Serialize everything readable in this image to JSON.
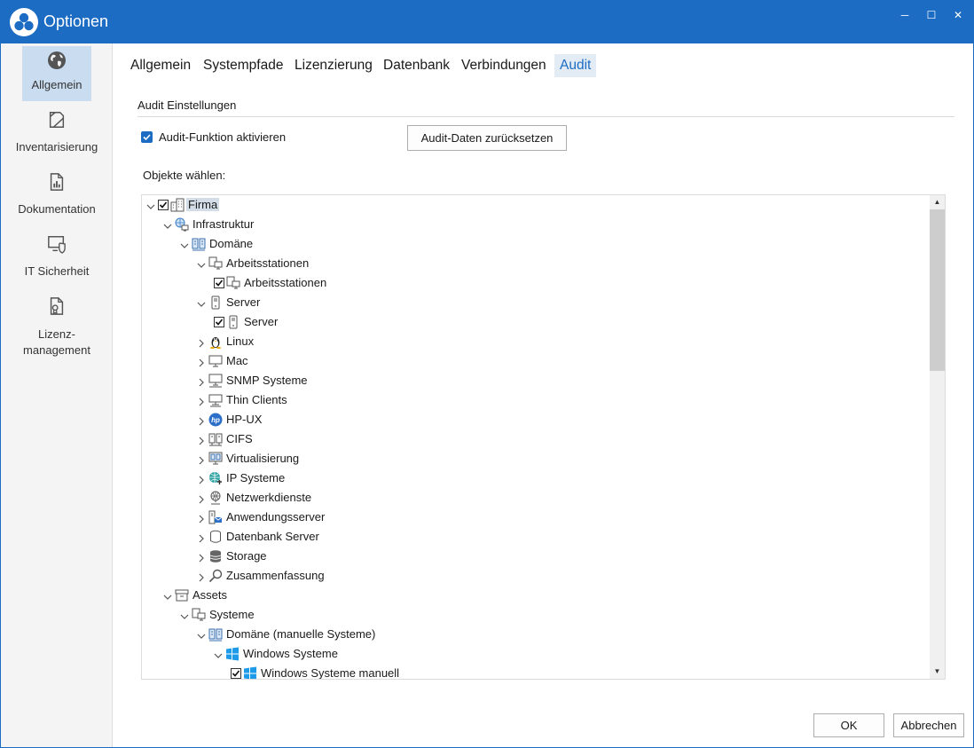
{
  "window": {
    "title": "Optionen",
    "title_color": "#1d6cc3",
    "controls": {
      "minimize": "─",
      "maximize": "☐",
      "close": "✕"
    }
  },
  "sidebar": {
    "items": [
      {
        "label": "Allgemein",
        "icon": "globe-icon",
        "active": true
      },
      {
        "label": "Inventarisierung",
        "icon": "inventory-icon",
        "active": false
      },
      {
        "label": "Dokumentation",
        "icon": "document-chart-icon",
        "active": false
      },
      {
        "label": "IT Sicherheit",
        "icon": "shield-monitor-icon",
        "active": false
      },
      {
        "label": "Lizenz-",
        "label2": "management",
        "icon": "license-icon",
        "active": false
      }
    ]
  },
  "tabs": [
    {
      "label": "Allgemein",
      "active": false
    },
    {
      "label": "Systempfade",
      "active": false
    },
    {
      "label": "Lizenzierung",
      "active": false
    },
    {
      "label": "Datenbank",
      "active": false
    },
    {
      "label": "Verbindungen",
      "active": false
    },
    {
      "label": "Audit",
      "active": true
    }
  ],
  "audit": {
    "section_title": "Audit Einstellungen",
    "enable_label": "Audit-Funktion aktivieren",
    "enable_checked": true,
    "reset_button": "Audit-Daten zurücksetzen",
    "objects_label": "Objekte wählen:"
  },
  "tree": [
    {
      "label": "Firma",
      "level": 0,
      "expanded": true,
      "checkbox": true,
      "checked": true,
      "icon": "building-icon",
      "selected": true
    },
    {
      "label": "Infrastruktur",
      "level": 1,
      "expanded": true,
      "checkbox": false,
      "icon": "network-globe-icon"
    },
    {
      "label": "Domäne",
      "level": 2,
      "expanded": true,
      "checkbox": false,
      "icon": "domain-icon"
    },
    {
      "label": "Arbeitsstationen",
      "level": 3,
      "expanded": true,
      "checkbox": false,
      "icon": "workstation-icon"
    },
    {
      "label": "Arbeitsstationen",
      "level": 4,
      "leaf": true,
      "checkbox": true,
      "checked": true,
      "icon": "workstation-icon"
    },
    {
      "label": "Server",
      "level": 3,
      "expanded": true,
      "checkbox": false,
      "icon": "server-icon"
    },
    {
      "label": "Server",
      "level": 4,
      "leaf": true,
      "checkbox": true,
      "checked": true,
      "icon": "server-icon"
    },
    {
      "label": "Linux",
      "level": 3,
      "expanded": false,
      "checkbox": false,
      "icon": "linux-icon"
    },
    {
      "label": "Mac",
      "level": 3,
      "expanded": false,
      "checkbox": false,
      "icon": "monitor-icon"
    },
    {
      "label": "SNMP Systeme",
      "level": 3,
      "expanded": false,
      "checkbox": false,
      "icon": "snmp-icon"
    },
    {
      "label": "Thin Clients",
      "level": 3,
      "expanded": false,
      "checkbox": false,
      "icon": "thin-client-icon"
    },
    {
      "label": "HP-UX",
      "level": 3,
      "expanded": false,
      "checkbox": false,
      "icon": "hp-icon"
    },
    {
      "label": "CIFS",
      "level": 3,
      "expanded": false,
      "checkbox": false,
      "icon": "cifs-icon"
    },
    {
      "label": "Virtualisierung",
      "level": 3,
      "expanded": false,
      "checkbox": false,
      "icon": "virtualization-icon"
    },
    {
      "label": "IP Systeme",
      "level": 3,
      "expanded": false,
      "checkbox": false,
      "icon": "ip-globe-icon"
    },
    {
      "label": "Netzwerkdienste",
      "level": 3,
      "expanded": false,
      "checkbox": false,
      "icon": "network-service-icon"
    },
    {
      "label": "Anwendungsserver",
      "level": 3,
      "expanded": false,
      "checkbox": false,
      "icon": "app-server-icon"
    },
    {
      "label": "Datenbank Server",
      "level": 3,
      "expanded": false,
      "checkbox": false,
      "icon": "database-icon"
    },
    {
      "label": "Storage",
      "level": 3,
      "expanded": false,
      "checkbox": false,
      "icon": "storage-icon"
    },
    {
      "label": "Zusammenfassung",
      "level": 3,
      "expanded": false,
      "checkbox": false,
      "icon": "search-icon"
    },
    {
      "label": "Assets",
      "level": 1,
      "expanded": true,
      "checkbox": false,
      "icon": "archive-box-icon"
    },
    {
      "label": "Systeme",
      "level": 2,
      "expanded": true,
      "checkbox": false,
      "icon": "workstation-icon"
    },
    {
      "label": "Domäne (manuelle Systeme)",
      "level": 3,
      "expanded": true,
      "checkbox": false,
      "icon": "domain-icon"
    },
    {
      "label": "Windows Systeme",
      "level": 4,
      "expanded": true,
      "checkbox": false,
      "icon": "windows-icon"
    },
    {
      "label": "Windows Systeme manuell",
      "level": 5,
      "leaf": true,
      "checkbox": true,
      "checked": true,
      "icon": "windows-icon"
    }
  ],
  "footer": {
    "ok": "OK",
    "cancel": "Abbrechen"
  },
  "scrollbar": {
    "position": 0.0,
    "visible_fraction": 0.35
  }
}
